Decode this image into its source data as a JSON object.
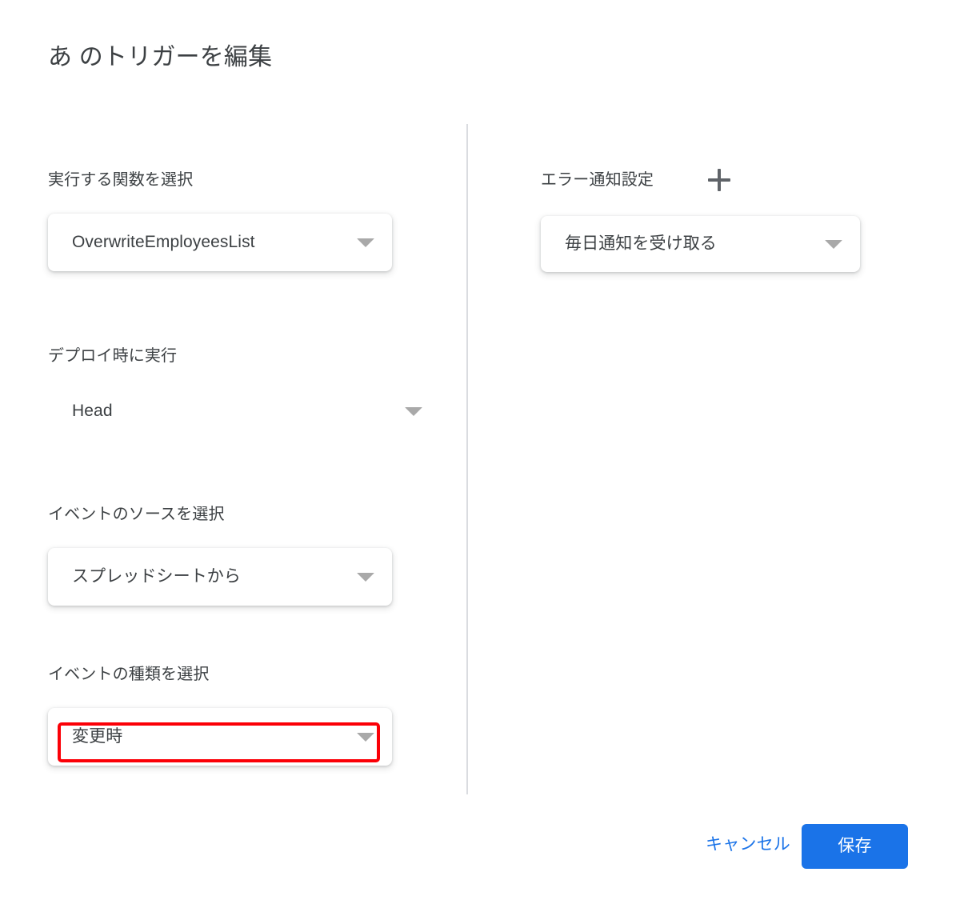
{
  "dialog": {
    "title": "あ のトリガーを編集"
  },
  "left_column": {
    "fields": [
      {
        "label": "実行する関数を選択",
        "value": "OverwriteEmployeesList",
        "caret_icon": "chevron-down-icon",
        "style": "card"
      },
      {
        "label": "デプロイ時に実行",
        "value": "Head",
        "caret_icon": "chevron-down-icon",
        "style": "flat"
      },
      {
        "label": "イベントのソースを選択",
        "value": "スプレッドシートから",
        "caret_icon": "chevron-down-icon",
        "style": "card"
      },
      {
        "label": "イベントの種類を選択",
        "value": "変更時",
        "caret_icon": "chevron-down-icon",
        "style": "card",
        "highlighted": true
      }
    ]
  },
  "right_column": {
    "label": "エラー通知設定",
    "add_icon": "plus-icon",
    "notification": {
      "value": "毎日通知を受け取る",
      "caret_icon": "chevron-down-icon"
    }
  },
  "footer": {
    "cancel_label": "キャンセル",
    "save_label": "保存"
  },
  "colors": {
    "accent_blue": "#1a73e8",
    "annotation_red": "#fb0007",
    "text_primary": "#3c4043",
    "divider": "#dadce0",
    "caret_gray": "#a9a9a9",
    "icon_gray": "#5f6368"
  }
}
